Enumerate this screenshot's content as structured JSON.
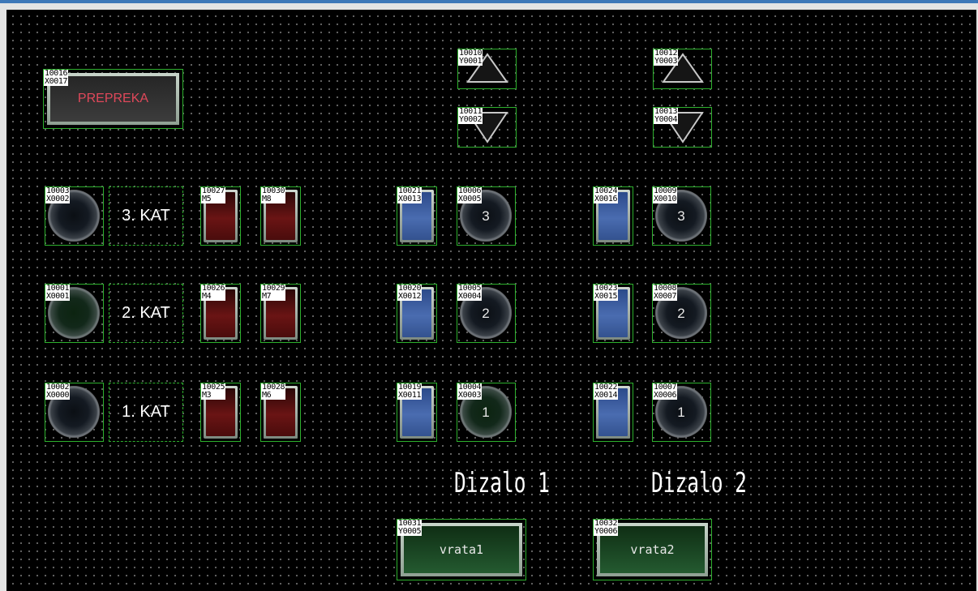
{
  "prepreka": {
    "addr": "10016",
    "io": "X0017",
    "label": "PREPREKA"
  },
  "arrows": {
    "e1_up": {
      "addr": "10010",
      "io": "Y0001"
    },
    "e1_down": {
      "addr": "10011",
      "io": "Y0002"
    },
    "e2_up": {
      "addr": "10012",
      "io": "Y0003"
    },
    "e2_down": {
      "addr": "10013",
      "io": "Y0004"
    }
  },
  "floors": [
    {
      "call": {
        "addr": "10003",
        "io": "X0002"
      },
      "label": "3. KAT",
      "m_a": {
        "addr": "10027",
        "io": "M5"
      },
      "m_b": {
        "addr": "10030",
        "io": "M8"
      },
      "e1_ind": {
        "addr": "10021",
        "io": "X0013"
      },
      "e1_btn": {
        "addr": "10006",
        "io": "X0005",
        "num": "3"
      },
      "e2_ind": {
        "addr": "10024",
        "io": "X0016"
      },
      "e2_btn": {
        "addr": "10009",
        "io": "X0010",
        "num": "3"
      }
    },
    {
      "call": {
        "addr": "10001",
        "io": "X0001"
      },
      "label": "2. KAT",
      "m_a": {
        "addr": "10026",
        "io": "M4"
      },
      "m_b": {
        "addr": "10029",
        "io": "M7"
      },
      "e1_ind": {
        "addr": "10020",
        "io": "X0012"
      },
      "e1_btn": {
        "addr": "10005",
        "io": "X0004",
        "num": "2"
      },
      "e2_ind": {
        "addr": "10023",
        "io": "X0015"
      },
      "e2_btn": {
        "addr": "10008",
        "io": "X0007",
        "num": "2"
      }
    },
    {
      "call": {
        "addr": "10002",
        "io": "X0000"
      },
      "label": "1. KAT",
      "m_a": {
        "addr": "10025",
        "io": "M3"
      },
      "m_b": {
        "addr": "10028",
        "io": "M6"
      },
      "e1_ind": {
        "addr": "10019",
        "io": "X0011"
      },
      "e1_btn": {
        "addr": "10004",
        "io": "X0003",
        "num": "1"
      },
      "e2_ind": {
        "addr": "10022",
        "io": "X0014"
      },
      "e2_btn": {
        "addr": "10007",
        "io": "X0006",
        "num": "1"
      }
    }
  ],
  "elevators": {
    "e1": "Dizalo 1",
    "e2": "Dizalo 2"
  },
  "doors": {
    "e1": {
      "addr": "10031",
      "io": "Y0005",
      "label": "vrata1"
    },
    "e2": {
      "addr": "10032",
      "io": "Y0006",
      "label": "vrata2"
    }
  },
  "colors": {
    "frame": "#2db02d",
    "indicator_red": "#6a1414",
    "indicator_blue": "#4a6cb0",
    "alarm_text": "#e0485a"
  }
}
